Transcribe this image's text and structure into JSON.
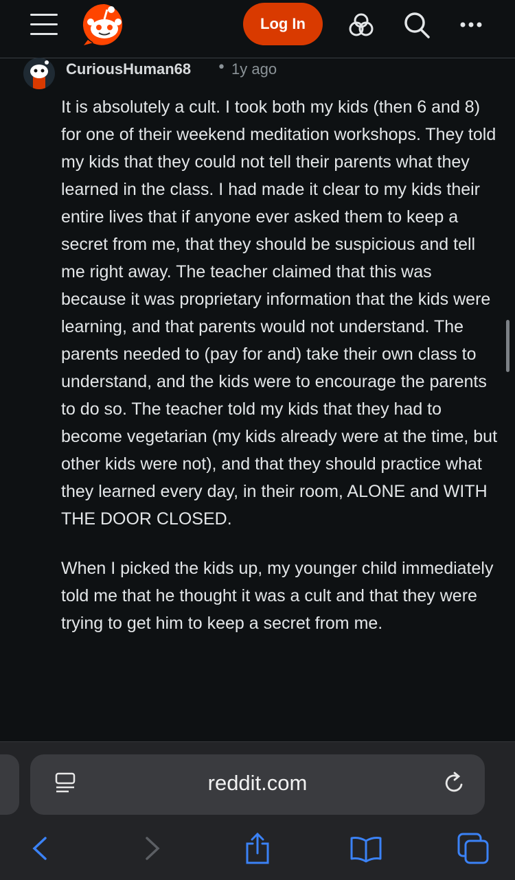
{
  "header": {
    "login_label": "Log In",
    "icons": [
      "menu-icon",
      "reddit-logo",
      "games-icon",
      "search-icon",
      "more-icon"
    ],
    "accent_color": "#d93a00"
  },
  "comment": {
    "username": "CuriousHuman68",
    "separator": "•",
    "age": "1y ago",
    "paragraphs": [
      "It is absolutely a cult. I took both my kids (then 6 and 8) for one of their weekend meditation workshops. They told my kids that they could not tell their parents what they learned in the class. I had made it clear to my kids their entire lives that if anyone ever asked them to keep a secret from me, that they should be suspicious and tell me right away. The teacher claimed that this was because it was proprietary information that the kids were learning, and that parents would not understand. The parents needed to (pay for and) take their own class to understand, and the kids were to encourage the parents to do so. The teacher told my kids that they had to become vegetarian (my kids already were at the time, but other kids were not), and that they should practice what they learned every day, in their room, ALONE and WITH THE DOOR CLOSED.",
      "When I picked the kids up, my younger child immediately told me that he thought it was a cult and that they were trying to get him to keep a secret from me."
    ]
  },
  "browser": {
    "url": "reddit.com",
    "icons": [
      "reader-icon",
      "reload-icon",
      "back-icon",
      "forward-icon",
      "share-icon",
      "bookmarks-icon",
      "tabs-icon"
    ]
  }
}
